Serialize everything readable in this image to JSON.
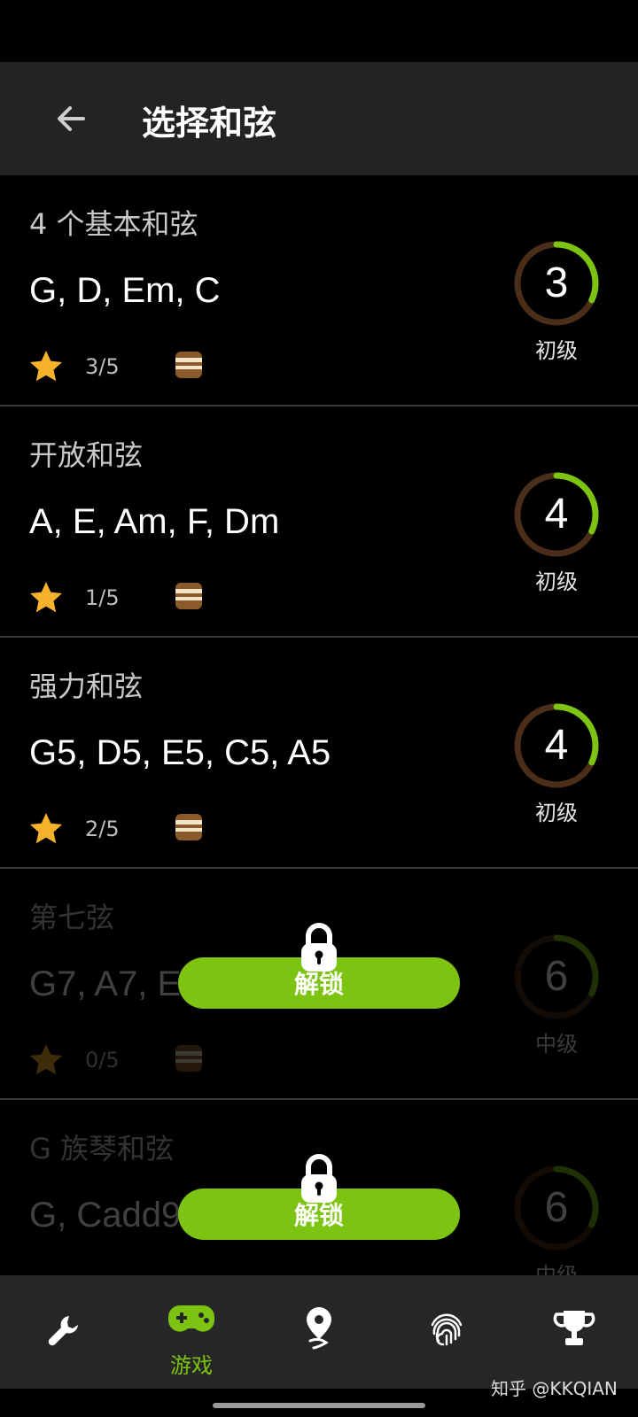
{
  "app_bar": {
    "title": "选择和弦"
  },
  "cards": [
    {
      "title": "4 个基本和弦",
      "chords": "G, D, Em, C",
      "score": "3/5",
      "level_number": "3",
      "level_label": "初级",
      "progress": 0.32,
      "locked": false
    },
    {
      "title": "开放和弦",
      "chords": "A, E, Am, F, Dm",
      "score": "1/5",
      "level_number": "4",
      "level_label": "初级",
      "progress": 0.32,
      "locked": false
    },
    {
      "title": "强力和弦",
      "chords": "G5, D5, E5, C5, A5",
      "score": "2/5",
      "level_number": "4",
      "level_label": "初级",
      "progress": 0.32,
      "locked": false
    },
    {
      "title": "第七弦",
      "chords": "G7, A7, E",
      "score": "0/5",
      "level_number": "6",
      "level_label": "中级",
      "progress": 0.32,
      "locked": true,
      "unlock_label": "解锁"
    },
    {
      "title": "G 族琴和弦",
      "chords": "G, Cadd9",
      "score": "",
      "level_number": "6",
      "level_label": "中级",
      "progress": 0.32,
      "locked": true,
      "unlock_label": "解锁"
    }
  ],
  "bottom_nav": {
    "items": [
      {
        "icon": "wrench-icon",
        "label": ""
      },
      {
        "icon": "gamepad-icon",
        "label": "游戏"
      },
      {
        "icon": "map-pin-icon",
        "label": ""
      },
      {
        "icon": "fingerprint-icon",
        "label": ""
      },
      {
        "icon": "trophy-icon",
        "label": ""
      }
    ]
  },
  "watermark": "知乎 @KKQIAN",
  "colors": {
    "accent": "#7dc312",
    "star": "#f6b22a",
    "ring_track": "#4a2e1a",
    "app_bar": "#232323",
    "nav_bg": "#262626"
  }
}
